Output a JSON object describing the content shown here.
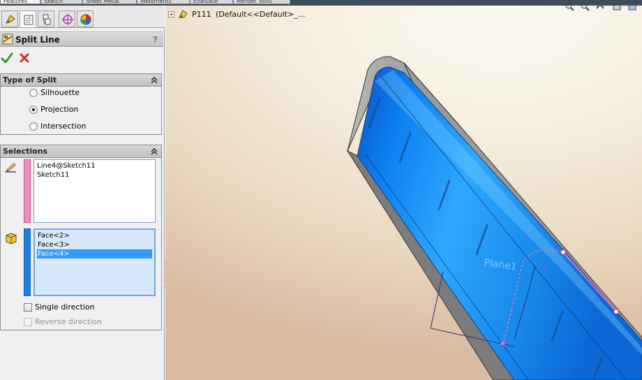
{
  "top_tabs": [
    "Features",
    "Sketch",
    "Sheet Metal",
    "Weldments",
    "Evaluate",
    "Render Tools"
  ],
  "property_manager": {
    "title": "Split Line",
    "help": "?",
    "type_of_split": {
      "header": "Type of Split",
      "options": [
        {
          "label": "Silhouette",
          "checked": false
        },
        {
          "label": "Projection",
          "checked": true
        },
        {
          "label": "Intersection",
          "checked": false
        }
      ]
    },
    "selections": {
      "header": "Selections",
      "sketch_list": [
        "Line4@Sketch11",
        "Sketch11"
      ],
      "face_list": [
        "Face<2>",
        "Face<3>",
        "Face<4>"
      ],
      "face_selected_index": 2,
      "single_direction": {
        "label": "Single direction",
        "checked": false
      },
      "reverse_direction": {
        "label": "Reverse direction",
        "checked": false,
        "enabled": false
      }
    },
    "colors": {
      "sketch_bar": "#f08cc0",
      "face_bar": "#1f7fe0"
    }
  },
  "feature_tree": {
    "part_name": "P111",
    "config": "(Default<<Default>_..."
  },
  "model_label": "Plane1"
}
